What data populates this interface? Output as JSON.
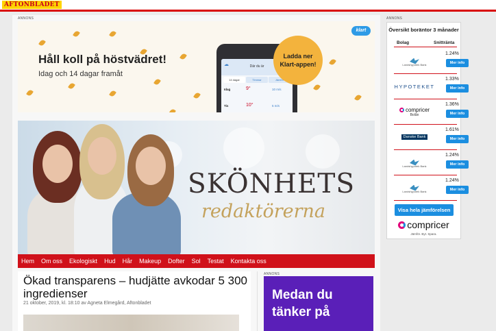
{
  "header": {
    "logo": "AFTONBLADET"
  },
  "ads": {
    "label_top": "ANNONS",
    "label_right": "ANNONS",
    "label_bottom": "ANNONS"
  },
  "weather_ad": {
    "title": "Håll koll på höstvädret!",
    "subtitle": "Idag och 14 dagar framåt",
    "brand": "klart",
    "bubble_line1": "Ladda ner",
    "bubble_line2": "Klart-appen!",
    "phone": {
      "header": "Där du är",
      "tabs": [
        "14 dagar",
        "Timmar",
        "Jämför"
      ],
      "rows": [
        {
          "day": "Idag",
          "temp": "9°",
          "wind": "10 m/s"
        },
        {
          "day": "Tis",
          "temp": "10°",
          "wind": "5 m/s"
        }
      ]
    }
  },
  "hero": {
    "title": "SKÖNHETS",
    "subtitle": "redaktörerna"
  },
  "nav": {
    "items": [
      "Hem",
      "Om oss",
      "Ekologiskt",
      "Hud",
      "Hår",
      "Makeup",
      "Dofter",
      "Sol",
      "Testat",
      "Kontakta oss"
    ]
  },
  "article": {
    "title": "Ökad transparens – hudjätte avkodar 5 300 ingredienser",
    "meta": "21 oktober, 2019, kl. 18:10 av Agneta Elmegård, Aftonbladet"
  },
  "purple_ad": {
    "line1": "Medan du",
    "line2": "tänker på"
  },
  "rates": {
    "title": "Översikt boräntor 3 månader",
    "col_bank": "Bolag",
    "col_rate": "Snittränta",
    "button_label": "Mer info",
    "rows": [
      {
        "bank": "Landshypotek Bank",
        "rate": "1.24%"
      },
      {
        "bank": "HYPOTEKET",
        "rate": "1.33%"
      },
      {
        "bank": "compricer",
        "bank_sub": "Bolån",
        "rate": "1.36%"
      },
      {
        "bank": "Danske Bank",
        "rate": "1.61%"
      },
      {
        "bank": "Landshypotek Bank",
        "rate": "1.24%"
      },
      {
        "bank": "Landshypotek Bank",
        "rate": "1.24%"
      }
    ],
    "cta": "Visa hela jämförelsen",
    "footer_brand": "compricer",
    "footer_tagline": "Jämför. Byt. Spara."
  },
  "colors": {
    "accent_red": "#d0111a",
    "button_blue": "#1b8ee0",
    "ad_purple": "#5a1fb8",
    "bubble_yellow": "#f3b33d"
  }
}
